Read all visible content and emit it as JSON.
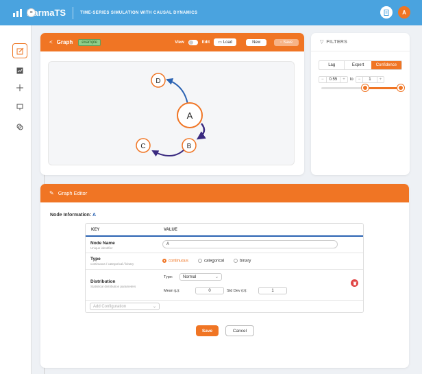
{
  "app": {
    "brand": "KarmaTS",
    "tagline": "TIME-SERIES SIMULATION WITH CAUSAL DYNAMICS",
    "avatar_initial": "A"
  },
  "graph_panel": {
    "title": "Graph",
    "badge": "example",
    "view_label": "View",
    "edit_label": "Edit",
    "load_label": "Load",
    "new_label": "New",
    "save_label": "Save"
  },
  "graph": {
    "nodes": [
      "A",
      "B",
      "C",
      "D"
    ]
  },
  "filters": {
    "title": "FILTERS",
    "tabs": [
      "Lag",
      "Expert",
      "Confidence"
    ],
    "active_tab": "Confidence",
    "range_min": "0.55",
    "to_label": "to",
    "range_max": "1",
    "minus": "−",
    "plus": "+",
    "slider_low_frac": 0.55,
    "slider_high_frac": 1.0
  },
  "editor": {
    "title": "Graph Editor",
    "node_info_label": "Node Information:",
    "node_id": "A",
    "col_key": "KEY",
    "col_value": "VALUE",
    "name_label": "Node Name",
    "name_sub": "Unique identifier",
    "name_value": "A",
    "type_label": "Type",
    "type_sub": "continuous / categorical / binary",
    "type_options": [
      "continuous",
      "categorical",
      "binary"
    ],
    "type_selected": "continuous",
    "dist_label": "Distribution",
    "dist_sub": "Statistical distribution parameters",
    "dist_type_label": "Type:",
    "dist_type_value": "Normal",
    "mean_label": "Mean (μ):",
    "mean_value": "0",
    "std_label": "Std Dev (σ):",
    "std_value": "1",
    "add_config_placeholder": "Add Configuration",
    "save_label": "Save",
    "cancel_label": "Cancel"
  },
  "colors": {
    "topbar": "#4aa3df",
    "accent": "#f07524",
    "edge": "#3a2a80",
    "edge_blue": "#2a62b2",
    "delete": "#e04545"
  }
}
